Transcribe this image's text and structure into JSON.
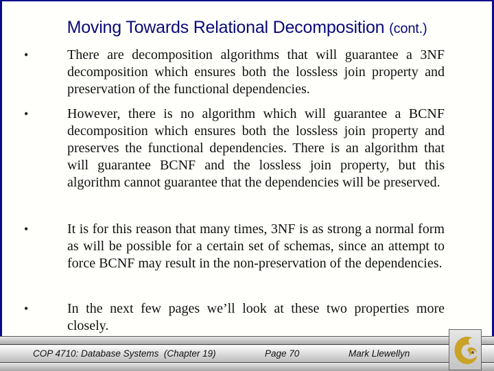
{
  "slide": {
    "title": "Moving Towards Relational Decomposition",
    "title_suffix": "(cont.)",
    "bullets": [
      {
        "marker": "•",
        "text": "There are decomposition algorithms that will guarantee a 3NF decomposition which ensures both the lossless join property and preservation of the functional dependencies."
      },
      {
        "marker": "•",
        "text": "However, there is no algorithm which will guarantee a BCNF decomposition which ensures both the lossless join property and preserves the functional dependencies.  There is an algorithm that will guarantee BCNF and the lossless join property, but this algorithm cannot guarantee that the dependencies will be preserved."
      },
      {
        "marker": "•",
        "text": "It is for this reason that many times, 3NF is as strong a normal form as will be possible for a certain set of schemas, since an attempt to force BCNF may result in the non-preservation of the dependencies."
      },
      {
        "marker": "•",
        "text": "In the next few pages we’ll look at these two properties more closely."
      }
    ]
  },
  "footer": {
    "course": "COP 4710: Database Systems  (Chapter 19)",
    "page": "Page 70",
    "author": "Mark Llewellyn",
    "logo_icon": "pegasus-logo-icon"
  },
  "colors": {
    "title": "#0a0a78",
    "border": "#0b0b8a",
    "logo_gold": "#c9a227"
  }
}
